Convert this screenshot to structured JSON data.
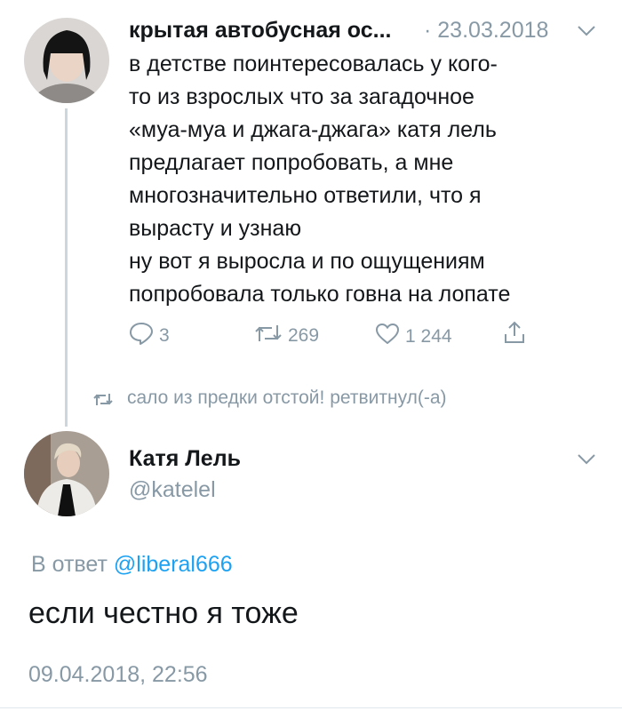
{
  "quoted_tweet": {
    "author_name": "крытая автобусная ос...",
    "separator": "·",
    "date": "23.03.2018",
    "text_lines": [
      "в детстве поинтересовалась у кого-",
      "то из взрослых что за загадочное",
      "«муа-муа и джага-джага» катя лель",
      "предлагает попробовать, а мне",
      "многозначительно ответили, что я",
      "вырасту и узнаю",
      "ну вот я выросла и по ощущениям",
      "попробовала только говна на лопате"
    ],
    "actions": {
      "reply_count": "3",
      "retweet_count": "269",
      "like_count": "1 244"
    },
    "retweeted_by": "сало из предки отстой! ретвитнул(-а)",
    "icons": [
      "reply-icon",
      "retweet-icon",
      "like-icon",
      "share-icon",
      "chevron-down-icon"
    ]
  },
  "reply_tweet": {
    "author_name": "Катя Лель",
    "handle": "@katelel",
    "reply_prefix": "В ответ",
    "reply_handle": "@liberal666",
    "text": "если честно я тоже",
    "timestamp": "09.04.2018, 22:56"
  },
  "colors": {
    "text_primary": "#14171a",
    "text_secondary": "#8899a6",
    "link_blue": "#1da1f2",
    "thread_line": "#ccd6dd"
  }
}
